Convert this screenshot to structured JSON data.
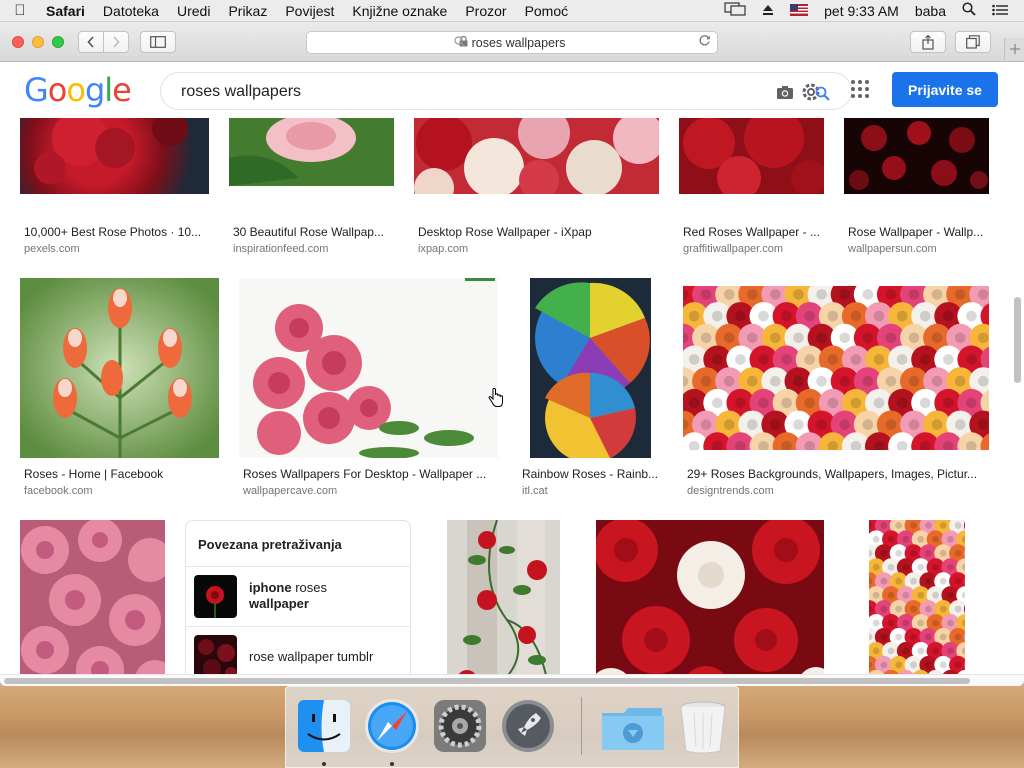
{
  "menubar": {
    "app_name": "Safari",
    "items": [
      "Datoteka",
      "Uredi",
      "Prikaz",
      "Povijest",
      "Knjižne oznake",
      "Prozor",
      "Pomoć"
    ],
    "clock": "pet 9:33 AM",
    "user": "baba"
  },
  "browser": {
    "address": "roses wallpapers"
  },
  "google": {
    "logo": [
      "G",
      "o",
      "o",
      "g",
      "l",
      "e"
    ],
    "search_value": "roses wallpapers",
    "signin_label": "Prijavite se"
  },
  "results": {
    "row1": [
      {
        "title": "10,000+ Best Rose Photos · 10...",
        "source": "pexels.com"
      },
      {
        "title": "30 Beautiful Rose Wallpap...",
        "source": "inspirationfeed.com"
      },
      {
        "title": "Desktop Rose Wallpaper - iXpap",
        "source": "ixpap.com"
      },
      {
        "title": "Red Roses Wallpaper - ...",
        "source": "graffitiwallpaper.com"
      },
      {
        "title": "Rose Wallpaper - Wallp...",
        "source": "wallpapersun.com"
      }
    ],
    "row2": [
      {
        "title": "Roses - Home | Facebook",
        "source": "facebook.com"
      },
      {
        "title": "Roses Wallpapers For Desktop - Wallpaper ...",
        "source": "wallpapercave.com"
      },
      {
        "title": "Rainbow Roses - Rainb...",
        "source": "itl.cat"
      },
      {
        "title": "29+ Roses Backgrounds, Wallpapers, Images, Pictur...",
        "source": "designtrends.com"
      }
    ]
  },
  "related": {
    "title": "Povezana pretraživanja",
    "items": [
      {
        "bold_a": "iphone",
        "normal": " roses",
        "bold_b": "wallpaper"
      },
      {
        "text": "rose wallpaper tumblr"
      }
    ]
  },
  "colors": {
    "accent": "#1a73e8",
    "rose_red": "#b3121e",
    "rose_pink": "#e27a94"
  }
}
